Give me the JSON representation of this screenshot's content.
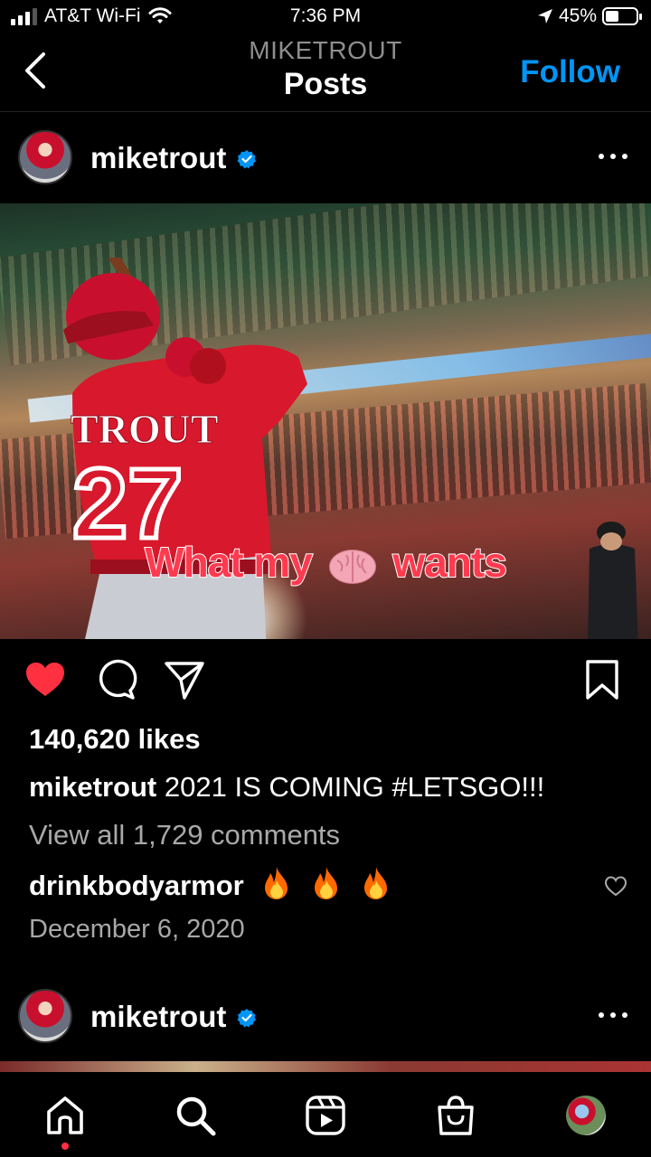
{
  "status_bar": {
    "carrier": "AT&T Wi-Fi",
    "time": "7:36 PM",
    "battery": "45%",
    "battery_level": 0.45
  },
  "header": {
    "subtitle": "MIKETROUT",
    "title": "Posts",
    "follow_label": "Follow"
  },
  "post": {
    "username": "miketrout",
    "verified": true,
    "image": {
      "jersey_name": "TROUT",
      "jersey_number": "27",
      "overlay_text_before": "What my",
      "overlay_emoji": "brain-icon",
      "overlay_text_after": "wants"
    },
    "liked": true,
    "likes": "140,620 likes",
    "caption_user": "miketrout",
    "caption_text": "2021 IS COMING #LETSGO!!!",
    "view_comments": "View all 1,729 comments",
    "comment_user": "drinkbodyarmor",
    "comment_emoji": [
      "fire-icon",
      "fire-icon",
      "fire-icon"
    ],
    "date": "December 6, 2020"
  },
  "next_post": {
    "username": "miketrout",
    "verified": true
  },
  "bottom_nav": {
    "items": [
      "home-icon",
      "search-icon",
      "reels-icon",
      "shop-icon",
      "profile-avatar"
    ],
    "active": "home-icon"
  },
  "colors": {
    "accent": "#0095f6",
    "like_red": "#ff3040",
    "secondary_text": "#a8a8a8",
    "overlay_text": "#ff3a4f"
  }
}
